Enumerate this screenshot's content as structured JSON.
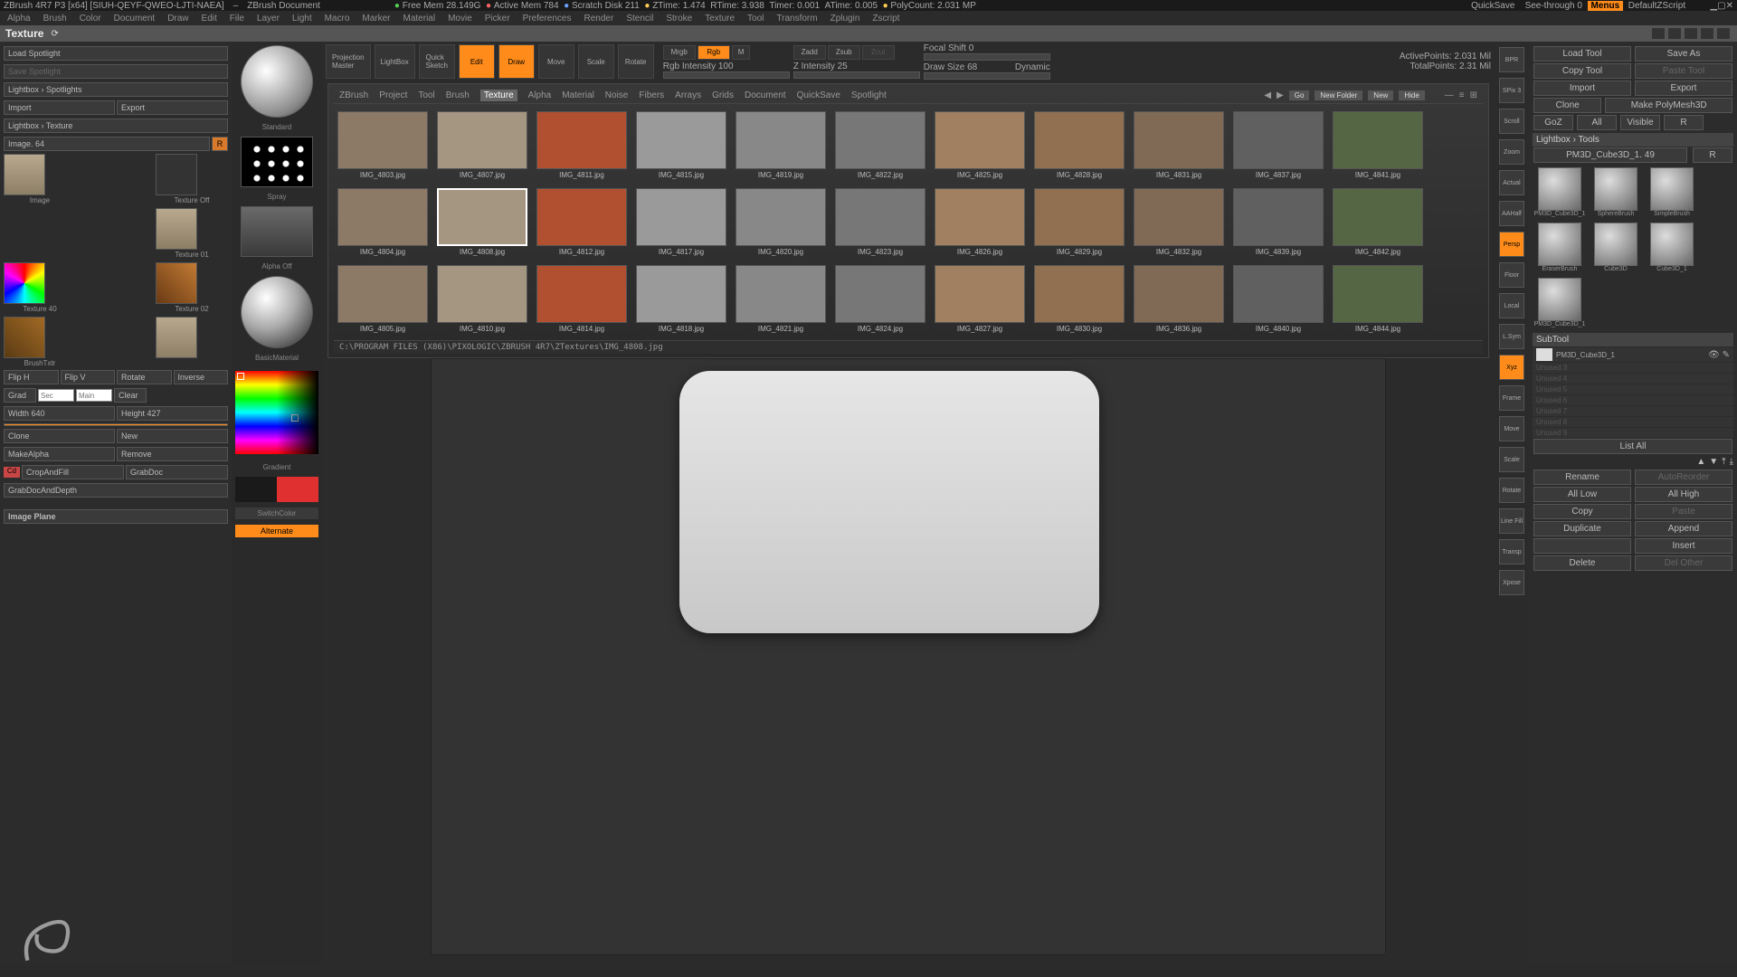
{
  "title_bar": {
    "app": "ZBrush 4R7 P3 [x64]",
    "doc": "[SIUH-QEYF-QWEO-LJTI-NAEA]",
    "doc_label": "ZBrush Document",
    "free_mem": "Free Mem 28.149G",
    "active_mem": "Active Mem 784",
    "scratch": "Scratch Disk 211",
    "ztime": "ZTime: 1.474",
    "rtime": "RTime: 3.938",
    "timer": "Timer: 0.001",
    "atime": "ATime: 0.005",
    "polycount": "PolyCount: 2.031 MP",
    "quicksave": "QuickSave",
    "seethrough": "See-through  0",
    "menus": "Menus",
    "script": "DefaultZScript"
  },
  "menubar": [
    "Alpha",
    "Brush",
    "Color",
    "Document",
    "Draw",
    "Edit",
    "File",
    "Layer",
    "Light",
    "Macro",
    "Marker",
    "Material",
    "Movie",
    "Picker",
    "Preferences",
    "Render",
    "Stencil",
    "Stroke",
    "Texture",
    "Tool",
    "Transform",
    "Zplugin",
    "Zscript"
  ],
  "left": {
    "header": "Texture",
    "load_spotlight": "Load Spotlight",
    "save_spotlight": "Save Spotlight",
    "lightbox_spotlights": "Lightbox › Spotlights",
    "import": "Import",
    "export": "Export",
    "lightbox_texture": "Lightbox › Texture",
    "image_count": "Image. 64",
    "r_btn": "R",
    "thumb_lbls": [
      "Image",
      "Texture Off",
      "",
      "Texture 01",
      "Texture 40",
      "Texture 02",
      "BrushTxtr",
      ""
    ],
    "button_row1": [
      "Flip H",
      "Flip V",
      "Rotate",
      "Inverse"
    ],
    "grad": "Grad",
    "sec": "Sec",
    "main": "Main",
    "clear": "Clear",
    "width": "Width 640",
    "height": "Height 427",
    "clone": "Clone",
    "new": "New",
    "makealpha": "MakeAlpha",
    "remove": "Remove",
    "cropandfill": "CropAndFill",
    "grabdoc": "GrabDoc",
    "grabdocdepth": "GrabDocAndDepth",
    "image_plane": "Image Plane"
  },
  "slim": {
    "standard": "Standard",
    "spray": "Spray",
    "alpha_off": "Alpha Off",
    "mat": "BasicMaterial",
    "gradient": "Gradient",
    "switchcolor": "SwitchColor",
    "alternate": "Alternate"
  },
  "toolbar": {
    "proj_master": "Projection\nMaster",
    "lightbox": "LightBox",
    "quick_sketch": "Quick\nSketch",
    "edit": "Edit",
    "draw": "Draw",
    "move": "Move",
    "scale": "Scale",
    "rotate": "Rotate",
    "mrgb": "Mrgb",
    "rgb": "Rgb",
    "m": "M",
    "zadd": "Zadd",
    "zsub": "Zsub",
    "zcut": "Zcut",
    "rgb_int": "Rgb Intensity 100",
    "z_int": "Z Intensity 25",
    "focal": "Focal Shift 0",
    "draw_size": "Draw Size 68",
    "dynamic": "Dynamic",
    "active_pts": "ActivePoints: 2.031 Mil",
    "total_pts": "TotalPoints: 2.31 Mil"
  },
  "lightbox": {
    "tabs": [
      "ZBrush",
      "Project",
      "Tool",
      "Brush",
      "Texture",
      "Alpha",
      "Material",
      "Noise",
      "Fibers",
      "Arrays",
      "Grids",
      "Document",
      "QuickSave",
      "Spotlight"
    ],
    "active_tab": 4,
    "actions": {
      "go": "Go",
      "new_folder": "New Folder",
      "new": "New",
      "hide": "Hide"
    },
    "row1": [
      "IMG_4803.jpg",
      "IMG_4807.jpg",
      "IMG_4811.jpg",
      "IMG_4815.jpg",
      "IMG_4819.jpg",
      "IMG_4822.jpg",
      "IMG_4825.jpg",
      "IMG_4828.jpg",
      "IMG_4831.jpg",
      "IMG_4837.jpg",
      "IMG_4841.jpg"
    ],
    "row2": [
      "IMG_4804.jpg",
      "IMG_4808.jpg",
      "IMG_4812.jpg",
      "IMG_4817.jpg",
      "IMG_4820.jpg",
      "IMG_4823.jpg",
      "IMG_4826.jpg",
      "IMG_4829.jpg",
      "IMG_4832.jpg",
      "IMG_4839.jpg",
      "IMG_4842.jpg"
    ],
    "row3": [
      "IMG_4805.jpg",
      "IMG_4810.jpg",
      "IMG_4814.jpg",
      "IMG_4818.jpg",
      "IMG_4821.jpg",
      "IMG_4824.jpg",
      "IMG_4827.jpg",
      "IMG_4830.jpg",
      "IMG_4836.jpg",
      "IMG_4840.jpg",
      "IMG_4844.jpg"
    ],
    "selected": "IMG_4808.jpg",
    "path": "C:\\PROGRAM FILES (X86)\\PIXOLOGIC\\ZBRUSH 4R7\\ZTextures\\IMG_4808.jpg"
  },
  "right_tools": [
    "BPR",
    "SPix 3",
    "Scroll",
    "Zoom",
    "Actual",
    "AAHalf",
    "Persp",
    "Floor",
    "Local",
    "L.Sym",
    "Xyz",
    "Frame",
    "Move",
    "Scale",
    "Rotate",
    "Line Fill",
    "Transp",
    "Xpose"
  ],
  "right": {
    "load_tool": "Load Tool",
    "save_as": "Save As",
    "copy_tool": "Copy Tool",
    "paste_tool": "Paste Tool",
    "import": "Import",
    "export": "Export",
    "clone": "Clone",
    "make_pm3d": "Make PolyMesh3D",
    "goz": "GoZ",
    "all": "All",
    "visible": "Visible",
    "r": "R",
    "lightbox_tools": "Lightbox › Tools",
    "pm3d_name": "PM3D_Cube3D_1. 49",
    "brushes": [
      "PM3D_Cube3D_1",
      "SphereBrush",
      "SimpleBrush",
      "EraserBrush",
      "Cube3D",
      "Cube3D_1",
      "PM3D_Cube3D_1"
    ],
    "subtool_hdr": "SubTool",
    "subtools": [
      "PM3D_Cube3D_1",
      "Unused 3",
      "Unused 4",
      "Unused 5",
      "Unused 6",
      "Unused 7",
      "Unused 8",
      "Unused 9"
    ],
    "list_all": "List All",
    "rename": "Rename",
    "auto": "AutoReorder",
    "all_low": "All Low",
    "all_high": "All High",
    "copy": "Copy",
    "paste": "Paste",
    "duplicate": "Duplicate",
    "append": "Append",
    "insert": "Insert",
    "delete": "Delete",
    "del_other": "Del Other"
  }
}
